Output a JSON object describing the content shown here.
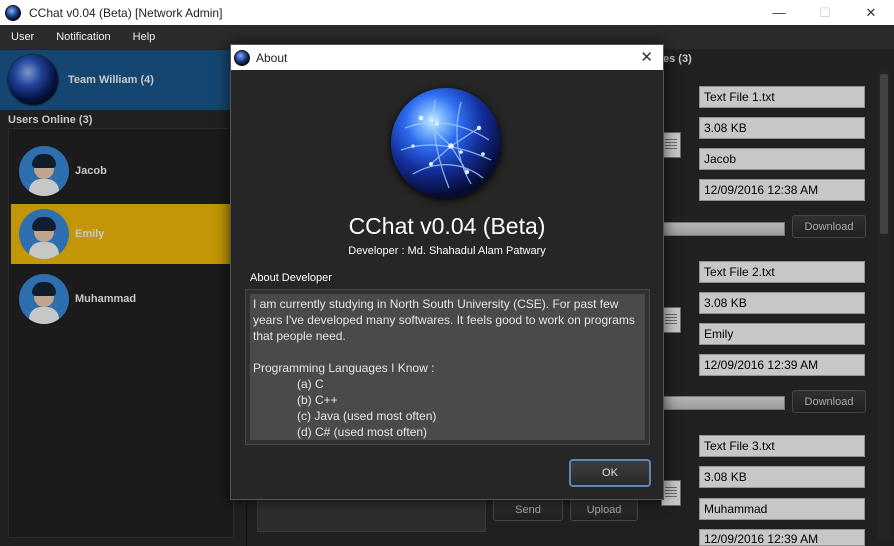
{
  "window": {
    "title": "CChat v0.04 (Beta) [Network Admin]",
    "minimize_glyph": "—",
    "maximize_glyph": "☐",
    "close_glyph": "✕"
  },
  "menubar": {
    "items": [
      "User",
      "Notification",
      "Help"
    ]
  },
  "team": {
    "name": "Team William (4)"
  },
  "users_online": {
    "title": "Users Online (3)",
    "users": [
      {
        "name": "Jacob",
        "active": false
      },
      {
        "name": "Emily",
        "active": true
      },
      {
        "name": "Muhammad",
        "active": false
      }
    ]
  },
  "chat": {
    "send_label": "Send",
    "upload_label": "Upload"
  },
  "files": {
    "title_visible": "es (3)",
    "items": [
      {
        "filename": "Text File 1.txt",
        "size": "3.08 KB",
        "sender": "Jacob",
        "timestamp": "12/09/2016 12:38 AM",
        "download_label": "Download"
      },
      {
        "filename": "Text File 2.txt",
        "size": "3.08 KB",
        "sender": "Emily",
        "timestamp": "12/09/2016 12:39 AM",
        "download_label": "Download"
      },
      {
        "filename": "Text File 3.txt",
        "size": "3.08 KB",
        "sender": "Muhammad",
        "timestamp": "12/09/2016 12:39 AM",
        "download_label": ""
      }
    ]
  },
  "about_dialog": {
    "title": "About",
    "close_glyph": "✕",
    "app_name": "CChat v0.04 (Beta)",
    "developer": "Developer : Md. Shahadul Alam Patwary",
    "about_label": "About Developer",
    "paragraph": "I am currently studying in North South University (CSE). For past few years I've developed many softwares. It feels good to work on programs that people need.",
    "languages_title": "Programming Languages I Know :",
    "languages": [
      "(a) C",
      "(b) C++",
      "(c) Java (used most often)",
      "(d) C# (used most often)"
    ],
    "ok_label": "OK"
  },
  "icons": {
    "app": "globe-network-icon",
    "user_avatar": "user-avatar-icon",
    "file": "text-file-icon"
  },
  "colors": {
    "team_header": "#1c5a92",
    "active_user": "#f9c10a",
    "background": "#2a2a2a",
    "ok_border": "#5a86b8"
  }
}
